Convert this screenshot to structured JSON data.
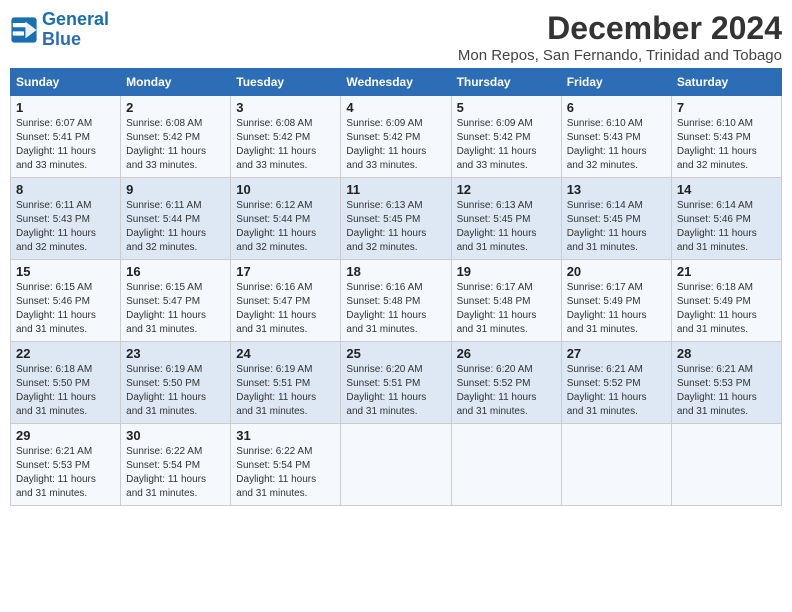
{
  "logo": {
    "line1": "General",
    "line2": "Blue"
  },
  "title": "December 2024",
  "subtitle": "Mon Repos, San Fernando, Trinidad and Tobago",
  "days_of_week": [
    "Sunday",
    "Monday",
    "Tuesday",
    "Wednesday",
    "Thursday",
    "Friday",
    "Saturday"
  ],
  "weeks": [
    [
      {
        "day": "1",
        "sunrise": "6:07 AM",
        "sunset": "5:41 PM",
        "daylight": "11 hours and 33 minutes."
      },
      {
        "day": "2",
        "sunrise": "6:08 AM",
        "sunset": "5:42 PM",
        "daylight": "11 hours and 33 minutes."
      },
      {
        "day": "3",
        "sunrise": "6:08 AM",
        "sunset": "5:42 PM",
        "daylight": "11 hours and 33 minutes."
      },
      {
        "day": "4",
        "sunrise": "6:09 AM",
        "sunset": "5:42 PM",
        "daylight": "11 hours and 33 minutes."
      },
      {
        "day": "5",
        "sunrise": "6:09 AM",
        "sunset": "5:42 PM",
        "daylight": "11 hours and 33 minutes."
      },
      {
        "day": "6",
        "sunrise": "6:10 AM",
        "sunset": "5:43 PM",
        "daylight": "11 hours and 32 minutes."
      },
      {
        "day": "7",
        "sunrise": "6:10 AM",
        "sunset": "5:43 PM",
        "daylight": "11 hours and 32 minutes."
      }
    ],
    [
      {
        "day": "8",
        "sunrise": "6:11 AM",
        "sunset": "5:43 PM",
        "daylight": "11 hours and 32 minutes."
      },
      {
        "day": "9",
        "sunrise": "6:11 AM",
        "sunset": "5:44 PM",
        "daylight": "11 hours and 32 minutes."
      },
      {
        "day": "10",
        "sunrise": "6:12 AM",
        "sunset": "5:44 PM",
        "daylight": "11 hours and 32 minutes."
      },
      {
        "day": "11",
        "sunrise": "6:13 AM",
        "sunset": "5:45 PM",
        "daylight": "11 hours and 32 minutes."
      },
      {
        "day": "12",
        "sunrise": "6:13 AM",
        "sunset": "5:45 PM",
        "daylight": "11 hours and 31 minutes."
      },
      {
        "day": "13",
        "sunrise": "6:14 AM",
        "sunset": "5:45 PM",
        "daylight": "11 hours and 31 minutes."
      },
      {
        "day": "14",
        "sunrise": "6:14 AM",
        "sunset": "5:46 PM",
        "daylight": "11 hours and 31 minutes."
      }
    ],
    [
      {
        "day": "15",
        "sunrise": "6:15 AM",
        "sunset": "5:46 PM",
        "daylight": "11 hours and 31 minutes."
      },
      {
        "day": "16",
        "sunrise": "6:15 AM",
        "sunset": "5:47 PM",
        "daylight": "11 hours and 31 minutes."
      },
      {
        "day": "17",
        "sunrise": "6:16 AM",
        "sunset": "5:47 PM",
        "daylight": "11 hours and 31 minutes."
      },
      {
        "day": "18",
        "sunrise": "6:16 AM",
        "sunset": "5:48 PM",
        "daylight": "11 hours and 31 minutes."
      },
      {
        "day": "19",
        "sunrise": "6:17 AM",
        "sunset": "5:48 PM",
        "daylight": "11 hours and 31 minutes."
      },
      {
        "day": "20",
        "sunrise": "6:17 AM",
        "sunset": "5:49 PM",
        "daylight": "11 hours and 31 minutes."
      },
      {
        "day": "21",
        "sunrise": "6:18 AM",
        "sunset": "5:49 PM",
        "daylight": "11 hours and 31 minutes."
      }
    ],
    [
      {
        "day": "22",
        "sunrise": "6:18 AM",
        "sunset": "5:50 PM",
        "daylight": "11 hours and 31 minutes."
      },
      {
        "day": "23",
        "sunrise": "6:19 AM",
        "sunset": "5:50 PM",
        "daylight": "11 hours and 31 minutes."
      },
      {
        "day": "24",
        "sunrise": "6:19 AM",
        "sunset": "5:51 PM",
        "daylight": "11 hours and 31 minutes."
      },
      {
        "day": "25",
        "sunrise": "6:20 AM",
        "sunset": "5:51 PM",
        "daylight": "11 hours and 31 minutes."
      },
      {
        "day": "26",
        "sunrise": "6:20 AM",
        "sunset": "5:52 PM",
        "daylight": "11 hours and 31 minutes."
      },
      {
        "day": "27",
        "sunrise": "6:21 AM",
        "sunset": "5:52 PM",
        "daylight": "11 hours and 31 minutes."
      },
      {
        "day": "28",
        "sunrise": "6:21 AM",
        "sunset": "5:53 PM",
        "daylight": "11 hours and 31 minutes."
      }
    ],
    [
      {
        "day": "29",
        "sunrise": "6:21 AM",
        "sunset": "5:53 PM",
        "daylight": "11 hours and 31 minutes."
      },
      {
        "day": "30",
        "sunrise": "6:22 AM",
        "sunset": "5:54 PM",
        "daylight": "11 hours and 31 minutes."
      },
      {
        "day": "31",
        "sunrise": "6:22 AM",
        "sunset": "5:54 PM",
        "daylight": "11 hours and 31 minutes."
      },
      null,
      null,
      null,
      null
    ]
  ]
}
